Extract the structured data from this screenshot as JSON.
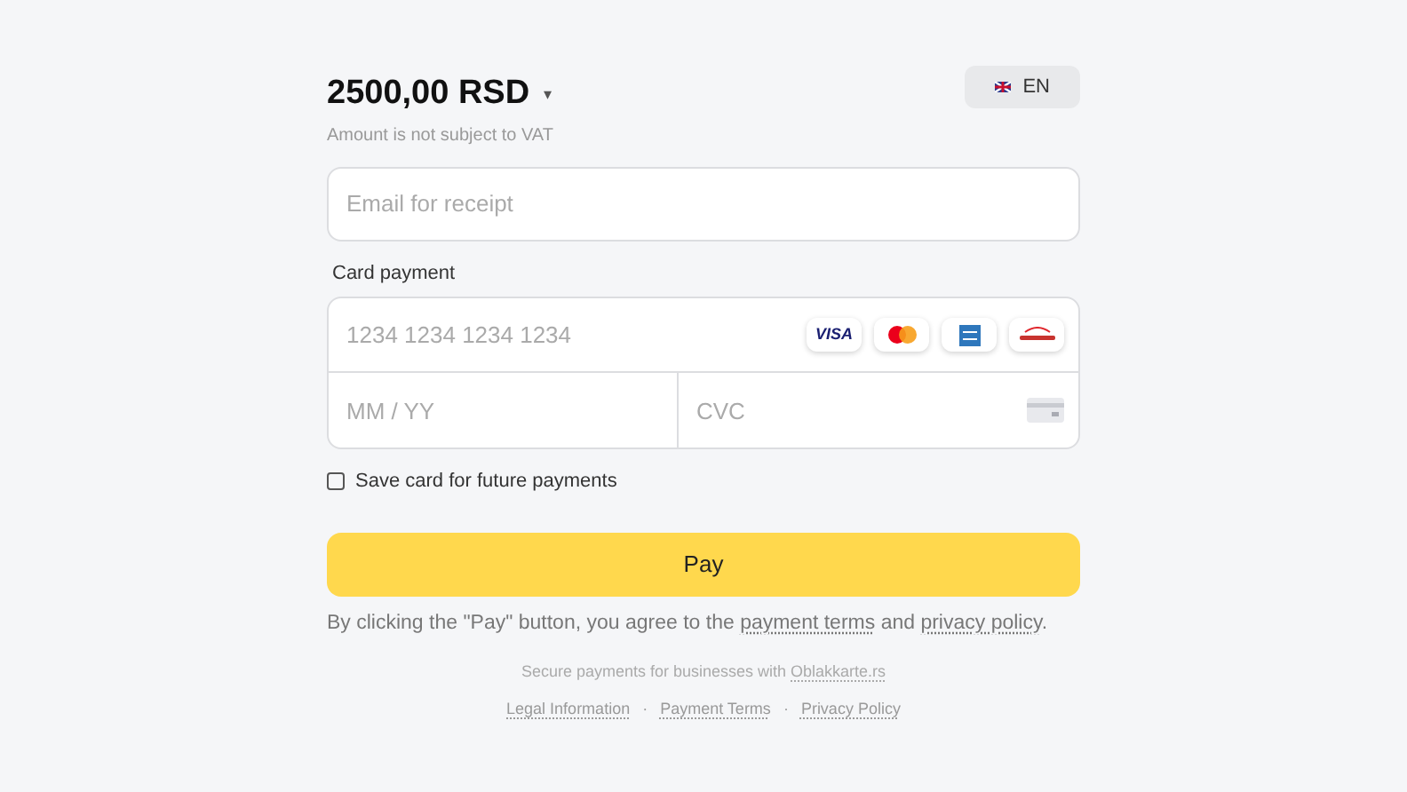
{
  "amount": {
    "value": "2500,00 RSD",
    "caret": "▾",
    "note": "Amount is not subject to VAT"
  },
  "language": {
    "label": "EN"
  },
  "email": {
    "placeholder": "Email for receipt"
  },
  "card": {
    "heading": "Card payment",
    "number_placeholder": "1234 1234 1234 1234",
    "expiry_placeholder": "MM / YY",
    "cvc_placeholder": "CVC",
    "brands": [
      {
        "kind": "visa",
        "label": "VISA"
      },
      {
        "kind": "mastercard"
      },
      {
        "kind": "amex"
      },
      {
        "kind": "diners"
      }
    ]
  },
  "save_card": {
    "label": "Save card for future payments",
    "checked": false
  },
  "pay_button": {
    "label": "Pay"
  },
  "agreement": {
    "before": "By clicking the \"Pay\" button, you agree to the ",
    "link_1": "payment terms",
    "middle": " and ",
    "link_2": "privacy policy",
    "after": "."
  },
  "footer": {
    "text": "Secure payments for businesses with ",
    "link": "Oblakkarte.rs",
    "links": [
      {
        "label": "Legal Information"
      },
      {
        "label": "Payment Terms"
      },
      {
        "label": "Privacy Policy"
      }
    ],
    "separator": "·"
  }
}
